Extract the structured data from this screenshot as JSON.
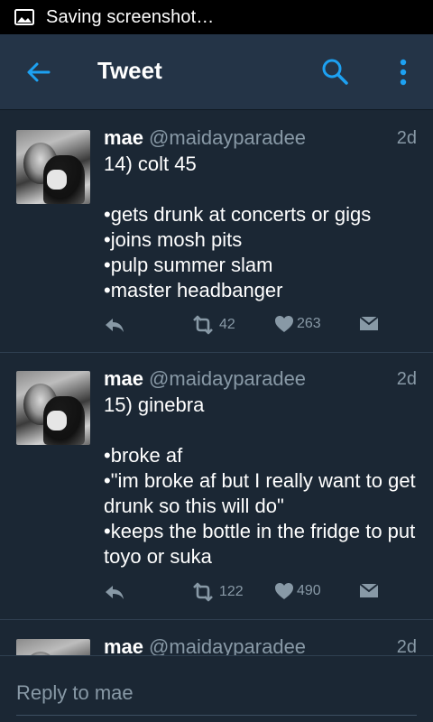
{
  "status_bar": {
    "icon": "image-icon",
    "text": "Saving screenshot…"
  },
  "app_bar": {
    "title": "Tweet",
    "back_icon": "back-arrow-icon",
    "search_icon": "search-icon",
    "more_icon": "more-vertical-icon",
    "accent": "#1da1f2"
  },
  "tweets": [
    {
      "name": "mae",
      "handle": "@maidayparadee",
      "time": "2d",
      "text": "14) colt 45\n\n•gets drunk at concerts or gigs\n•joins mosh pits\n•pulp summer slam\n•master headbanger",
      "retweets": "42",
      "likes": "263"
    },
    {
      "name": "mae",
      "handle": "@maidayparadee",
      "time": "2d",
      "text": "15) ginebra\n\n•broke af\n•\"im broke af but I really want to get drunk so this will do\"\n•keeps the bottle in the fridge to put toyo or suka",
      "retweets": "122",
      "likes": "490"
    },
    {
      "name": "mae",
      "handle": "@maidayparadee",
      "time": "2d"
    }
  ],
  "reply": {
    "placeholder": "Reply to mae"
  },
  "colors": {
    "background": "#1b2734",
    "app_bar": "#243447",
    "muted": "#8899a6"
  }
}
